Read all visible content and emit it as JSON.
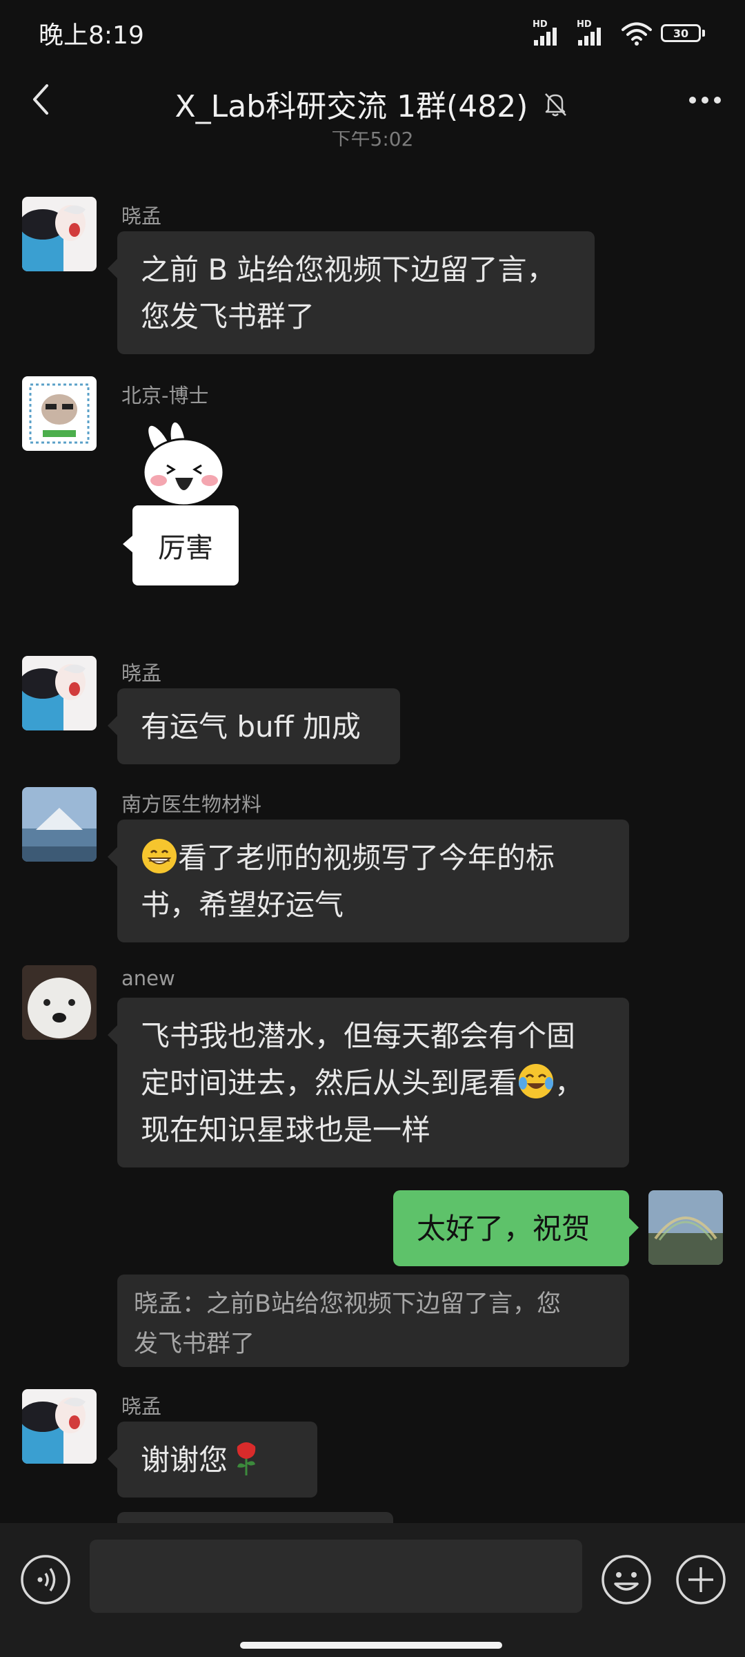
{
  "status_bar": {
    "time": "晚上8:19",
    "battery": "30",
    "network": [
      "HD",
      "HD"
    ]
  },
  "header": {
    "title": "X_Lab科研交流 1群(482)",
    "back_icon": "chevron-left-icon",
    "mute_icon": "bell-off-icon",
    "more_icon": "more-dots-icon"
  },
  "chat": {
    "timestamp": "下午5:02",
    "messages": [
      {
        "sender": "晓孟",
        "lines": [
          "之前 B 站给您视频下边留了言，",
          "您发飞书群了"
        ]
      },
      {
        "sender": "北京-博士",
        "sticker_text": "厉害"
      },
      {
        "sender": "晓孟",
        "lines": [
          "有运气 buff 加成"
        ]
      },
      {
        "sender": "南方医生物材料",
        "lines": [
          "看了老师的视频写了今年的标",
          "书，希望好运气"
        ],
        "emoji": "grinning-face-emoji"
      },
      {
        "sender": "anew",
        "lines": [
          "飞书我也潜水，但每天都会有个固",
          "定时间进去，然后从头到尾看",
          "，",
          "现在知识星球也是一样"
        ],
        "emoji": "tears-of-joy-emoji"
      },
      {
        "sender": "me",
        "lines": [
          "太好了，祝贺"
        ],
        "quote": [
          "晓孟：之前B站给您视频下边留了言，您",
          "发飞书群了"
        ]
      },
      {
        "sender": "晓孟",
        "lines": [
          "谢谢您"
        ],
        "emoji": "rose-emoji"
      }
    ]
  },
  "input_bar": {
    "voice_icon": "voice-icon",
    "emoji_icon": "emoji-icon",
    "plus_icon": "plus-icon"
  },
  "colors": {
    "background": "#111111",
    "bubble": "#2c2c2c",
    "my_bubble": "#5ec26a"
  }
}
